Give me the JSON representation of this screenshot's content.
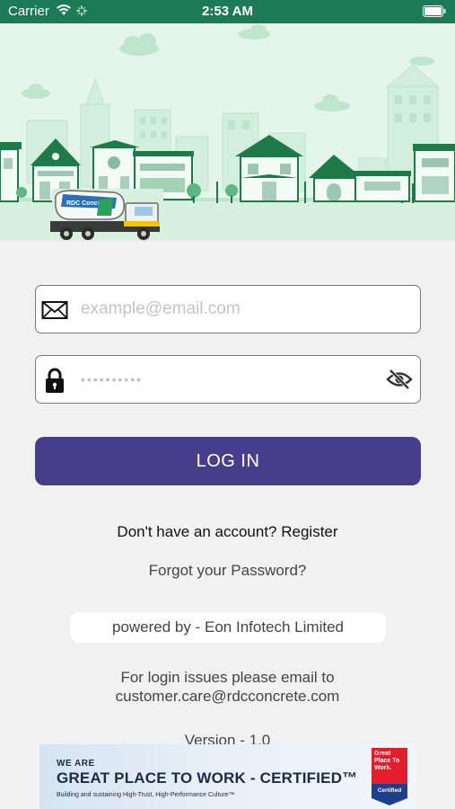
{
  "status_bar": {
    "carrier": "Carrier",
    "time": "2:53 AM"
  },
  "banner": {
    "truck_logo_text": "RDC Concrete"
  },
  "login_form": {
    "email_placeholder": "example@email.com",
    "password_placeholder": "••••••••••",
    "login_button": "LOG IN"
  },
  "links": {
    "register_prompt": "Don't have an account?",
    "register_label": "Register",
    "forgot_password": "Forgot your Password?"
  },
  "footer": {
    "powered_by": "powered by - Eon Infotech Limited",
    "support_line1": "For login issues please email to",
    "support_email": "customer.care@rdcconcrete.com",
    "version": "Version - 1.0"
  },
  "certification_banner": {
    "we_are": "WE ARE",
    "headline": "GREAT PLACE TO WORK - CERTIFIED™",
    "tagline": "Building and sustaining High-Trust, High-Performance Culture™",
    "badge_top": "Great Place To Work.",
    "badge_bottom": "Certified"
  },
  "icons": {
    "email": "envelope-icon",
    "password": "lock-icon",
    "visibility": "eye-slash-icon",
    "wifi": "wifi-icon",
    "battery": "battery-icon"
  },
  "colors": {
    "status_bar": "#1c7a57",
    "primary_button": "#483d8b",
    "banner_bg": "#e4f5ea",
    "brand_green": "#1f7a4a"
  }
}
